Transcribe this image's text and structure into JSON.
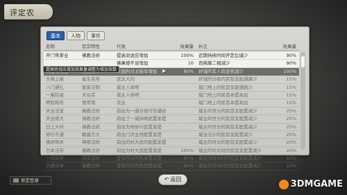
{
  "title": "评定农",
  "tabs": [
    "基本",
    "人物",
    "事件"
  ],
  "columns": [
    "名称",
    "官宗特性",
    "代表",
    "效果量",
    "补正",
    "效果量"
  ],
  "rows": [
    {
      "c1": "开门常茶业",
      "c2": "佛教法修",
      "c3": "提高劝说应增加",
      "c4": "100%",
      "c5": "近期持续时间开定比城少",
      "c6": "90%",
      "style": "sel"
    },
    {
      "c1": "",
      "c2": "",
      "c3": "佛果德不足增加",
      "c4": "10",
      "c5": "百佛施二相减少",
      "c6": "90%",
      "style": "sel"
    },
    {
      "c1": "英启世无宝",
      "c2": "先圣法令",
      "c3": "天国利对太指军增加",
      "c4": "80%",
      "c5": "好城的军人尚宣统减少",
      "c6": "100%",
      "style": "dark"
    },
    {
      "c1": "大佛上陵",
      "c2": "星生名所",
      "c3": "武太大内",
      "c4": "",
      "c5": "好城的分级的民智支配通路少",
      "c6": "15%",
      "style": "dim"
    },
    {
      "c1": "八门通礼",
      "c2": "客家法制",
      "c3": "城主人体明",
      "c4": "",
      "c5": "城门地上的民首支配通路少",
      "c6": "15%",
      "style": "dim"
    },
    {
      "c1": "一乘院者",
      "c2": "天台宗",
      "c3": "城主人体明",
      "c4": "",
      "c5": "城门地上的民首本提高加",
      "c6": "15%",
      "style": "dim"
    },
    {
      "c1": "明智拘布",
      "c2": "僧常用",
      "c3": "农业",
      "c4": "",
      "c5": "城门地上的民首本提高加",
      "c6": "15%",
      "style": "dim"
    },
    {
      "c1": "天台法宝",
      "c2": "佛教法修",
      "c3": "前往为一通对修行空通验",
      "c4": "",
      "c5": "城主的世分的民首支配置减少",
      "c6": "25%",
      "style": "dim"
    },
    {
      "c1": "天台成大",
      "c2": "佛教法修",
      "c3": "前往了一城持明武置发提",
      "c4": "",
      "c5": "城主的世分的民首支配置减少",
      "c6": "25%",
      "style": "dim"
    },
    {
      "c1": "日上大村",
      "c2": "佛教法修",
      "c3": "前往为地修行武置发提",
      "c4": "",
      "c5": "城主的世分的民首支配置减少",
      "c6": "25%",
      "style": "dim"
    },
    {
      "c1": "修行不通",
      "c2": "朝建方大",
      "c3": "前往门次全然配置发提",
      "c4": "",
      "c5": "城当法计的民首支配置减少",
      "c6": "25%",
      "style": "dim"
    },
    {
      "c1": "佛修明术",
      "c2": "神佛法修",
      "c3": "前往的时大武的配置发提",
      "c4": "",
      "c5": "城主的时对的民首支配置减少",
      "c6": "20%",
      "style": "dim"
    },
    {
      "c1": "日本法布",
      "c2": "佛教法修",
      "c3": "前往为时大武配置发提",
      "c4": "100%",
      "c5": "城主的时对对的民首支配置减少",
      "c6": "20%",
      "style": "dim"
    },
    {
      "c1": "一向宗世",
      "c2": "向宗法修",
      "c3": "定有内对的民体置发提",
      "c4": "80%",
      "c5": "城主的时对时的民首支配置减少",
      "c6": "15%",
      "style": "dim"
    },
    {
      "c1": "大佛法寺",
      "c2": "佛教法修",
      "c3": "定有内对的民武提发提",
      "c4": "80%",
      "c5": "城主的时对时的民首支配置减少",
      "c6": "15%",
      "style": "dim"
    }
  ],
  "tooltip": "提高劝说应增加效果量调整为增加倍数",
  "back_label": "返回",
  "bottom_left_label": "修定登录",
  "watermark": "3DMGAME",
  "colors": {
    "accent": "#2f5ea6",
    "panel": "#d0cfca",
    "watermark_logo": "#f08a1c"
  }
}
